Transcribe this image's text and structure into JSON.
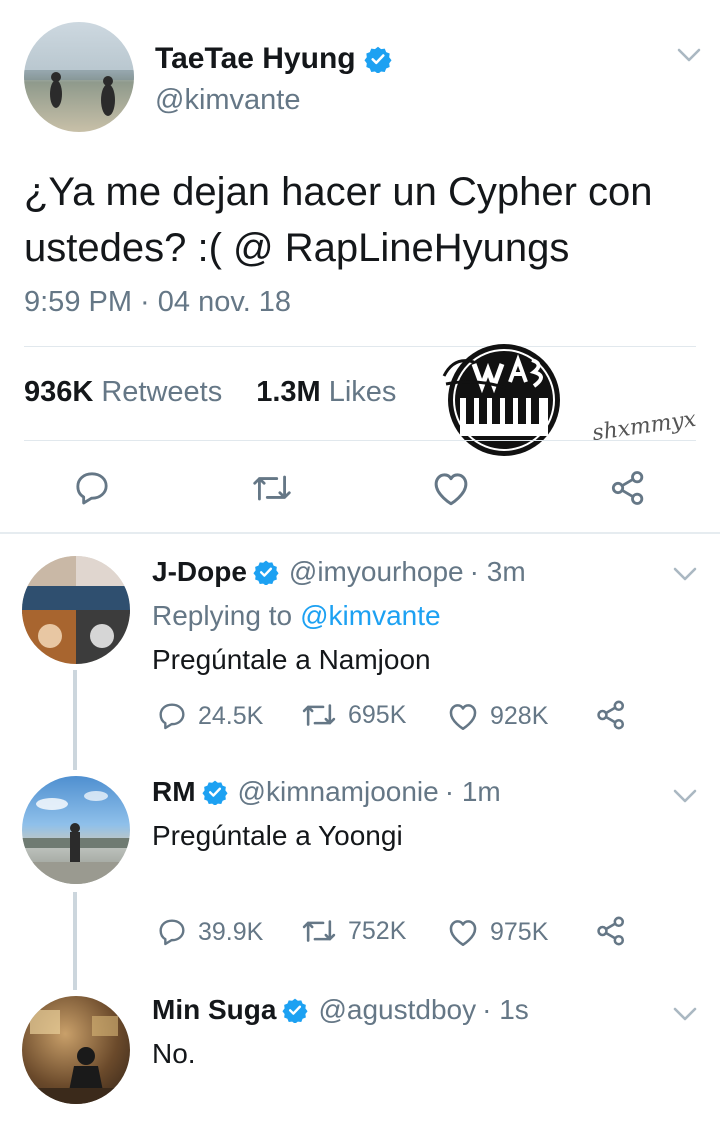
{
  "main_tweet": {
    "name": "TaeTae Hyung",
    "handle": "@kimvante",
    "text": "¿Ya me dejan hacer un Cypher con ustedes? :( @ RapLineHyungs",
    "timestamp": "9:59 PM · 04 nov. 18",
    "retweets_count": "936K",
    "retweets_label": "Retweets",
    "likes_count": "1.3M",
    "likes_label": "Likes"
  },
  "watermark": {
    "logo_text": "WAB Suga",
    "signature": "shxmmyx"
  },
  "replies": [
    {
      "name": "J-Dope",
      "handle": "@imyourhope",
      "time": "· 3m",
      "replying_prefix": "Replying to",
      "replying_to": "@kimvante",
      "text": "Pregúntale a Namjoon",
      "replies_count": "24.5K",
      "retweets_count": "695K",
      "likes_count": "928K"
    },
    {
      "name": "RM",
      "handle": "@kimnamjoonie",
      "time": "· 1m",
      "text": "Pregúntale a Yoongi",
      "replies_count": "39.9K",
      "retweets_count": "752K",
      "likes_count": "975K"
    },
    {
      "name": "Min Suga",
      "handle": "@agustdboy",
      "time": "· 1s",
      "text": "No."
    }
  ],
  "colors": {
    "accent": "#1da1f2",
    "muted": "#657786",
    "text": "#14171a",
    "divider": "#e1e8ed"
  }
}
